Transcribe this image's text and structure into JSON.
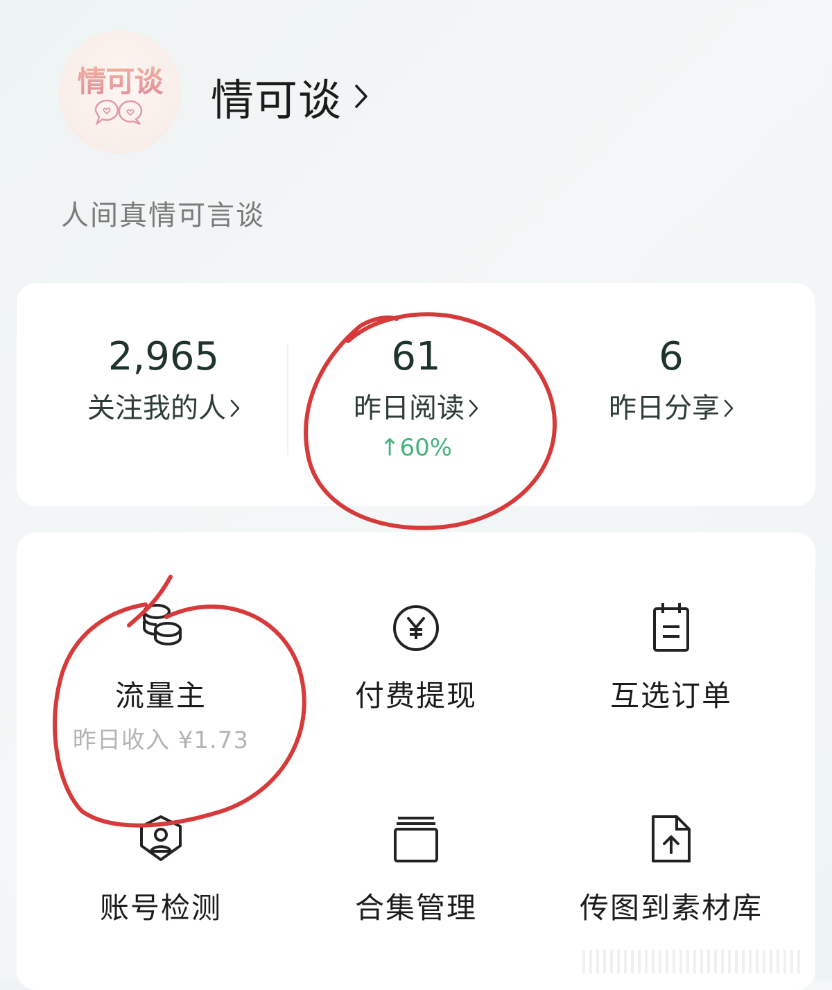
{
  "profile": {
    "avatar_text": "情可谈",
    "name": "情可谈",
    "bio": "人间真情可言谈"
  },
  "stats": [
    {
      "value": "2,965",
      "label": "关注我的人"
    },
    {
      "value": "61",
      "label": "昨日阅读",
      "trend": "↑60%"
    },
    {
      "value": "6",
      "label": "昨日分享"
    }
  ],
  "tools": [
    {
      "label": "流量主",
      "sub": "昨日收入 ¥1.73",
      "icon": "coins-icon"
    },
    {
      "label": "付费提现",
      "icon": "yuan-circle-icon"
    },
    {
      "label": "互选订单",
      "icon": "clipboard-icon"
    },
    {
      "label": "账号检测",
      "icon": "shield-user-icon"
    },
    {
      "label": "合集管理",
      "icon": "collection-icon"
    },
    {
      "label": "传图到素材库",
      "icon": "file-upload-icon"
    }
  ],
  "colors": {
    "accent_green": "#45b27d",
    "annotation_red": "#d63a3a",
    "avatar_pink": "#e28b9a"
  }
}
